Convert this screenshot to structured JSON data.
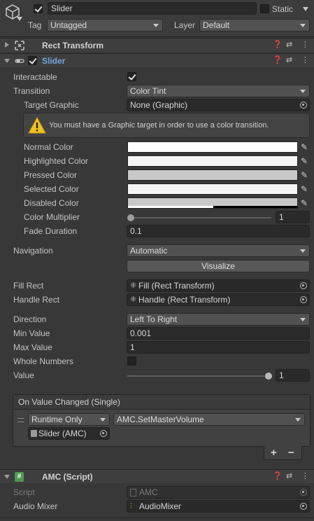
{
  "gameobject": {
    "name": "Slider",
    "static_label": "Static",
    "tag_label": "Tag",
    "tag_value": "Untagged",
    "layer_label": "Layer",
    "layer_value": "Default"
  },
  "rect_transform": {
    "title": "Rect Transform"
  },
  "slider": {
    "title": "Slider",
    "interactable_label": "Interactable",
    "transition_label": "Transition",
    "transition_value": "Color Tint",
    "target_graphic_label": "Target Graphic",
    "target_graphic_value": "None (Graphic)",
    "warning_text": "You must have a Graphic target in order to use a color transition.",
    "normal_color_label": "Normal Color",
    "highlighted_color_label": "Highlighted Color",
    "pressed_color_label": "Pressed Color",
    "selected_color_label": "Selected Color",
    "disabled_color_label": "Disabled Color",
    "color_multiplier_label": "Color Multiplier",
    "color_multiplier_value": "1",
    "color_multiplier_level": 0,
    "fade_duration_label": "Fade Duration",
    "fade_duration_value": "0.1",
    "navigation_label": "Navigation",
    "navigation_value": "Automatic",
    "visualize_label": "Visualize",
    "fill_rect_label": "Fill Rect",
    "fill_rect_value": "Fill (Rect Transform)",
    "handle_rect_label": "Handle Rect",
    "handle_rect_value": "Handle (Rect Transform)",
    "direction_label": "Direction",
    "direction_value": "Left To Right",
    "min_value_label": "Min Value",
    "min_value_value": "0.001",
    "max_value_label": "Max Value",
    "max_value_value": "1",
    "whole_numbers_label": "Whole Numbers",
    "value_label": "Value",
    "value_value": "1",
    "value_level": 1,
    "event_title": "On Value Changed (Single)",
    "event_mode": "Runtime Only",
    "event_function": "AMC.SetMasterVolume",
    "event_target": "Slider (AMC)",
    "add_label": "+",
    "remove_label": "−"
  },
  "amc": {
    "title": "AMC (Script)",
    "script_label": "Script",
    "script_value": "AMC",
    "audio_mixer_label": "Audio Mixer",
    "audio_mixer_value": "AudioMixer"
  },
  "colors": {
    "normal": "#ffffff",
    "highlighted": "#f5f5f5",
    "pressed": "#c8c8c8",
    "selected": "#f5f5f5",
    "disabled": "#c8c8c8",
    "slider_title": "#7aa6e0",
    "warning": "#f0c020"
  },
  "icons": {
    "gameobject": "cube-icon",
    "rect_transform": "rect-transform-icon",
    "slider": "slider-component-icon",
    "script": "csharp-script-icon",
    "warning": "warning-triangle-icon",
    "help": "help-icon",
    "presets": "presets-icon",
    "menu": "kebab-menu-icon"
  }
}
